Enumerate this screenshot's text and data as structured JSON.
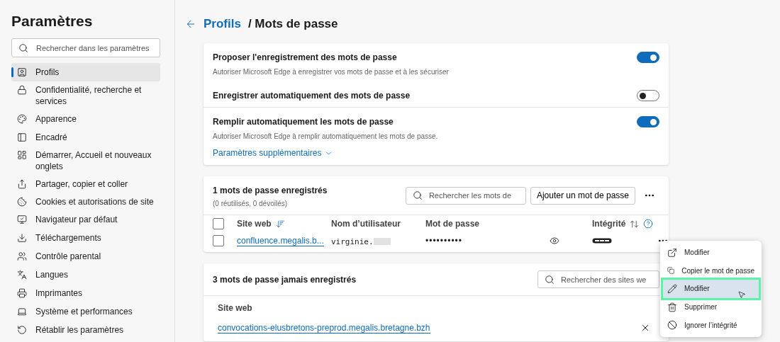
{
  "sidebar": {
    "title": "Paramètres",
    "search": {
      "placeholder": "Rechercher dans les paramètres"
    },
    "items": [
      {
        "label": "Profils",
        "selected": true
      },
      {
        "label": "Confidentialité, recherche et services",
        "selected": false
      },
      {
        "label": "Apparence",
        "selected": false
      },
      {
        "label": "Encadré",
        "selected": false
      },
      {
        "label": "Démarrer, Accueil et nouveaux onglets",
        "selected": false
      },
      {
        "label": "Partager, copier et coller",
        "selected": false
      },
      {
        "label": "Cookies et autorisations de site",
        "selected": false
      },
      {
        "label": "Navigateur par défaut",
        "selected": false
      },
      {
        "label": "Téléchargements",
        "selected": false
      },
      {
        "label": "Contrôle parental",
        "selected": false
      },
      {
        "label": "Langues",
        "selected": false
      },
      {
        "label": "Imprimantes",
        "selected": false
      },
      {
        "label": "Système et performances",
        "selected": false
      },
      {
        "label": "Rétablir les paramètres",
        "selected": false
      }
    ]
  },
  "breadcrumb": {
    "link": "Profils",
    "current": "/ Mots de passe"
  },
  "settings": {
    "rows": [
      {
        "label": "Proposer l'enregistrement des mots de passe",
        "description": "Autoriser Microsoft Edge à enregistrer vos mots de passe et à les sécuriser",
        "on": true
      },
      {
        "label": "Enregistrer automatiquement des mots de passe",
        "on": false
      },
      {
        "label": "Remplir automatiquement les mots de passe",
        "description": "Autoriser Microsoft Edge à remplir automatiquement les mots de passe.",
        "on": true
      }
    ],
    "more_link": "Paramètres supplémentaires"
  },
  "saved": {
    "title": "1 mots de passe enregistrés",
    "subtitle": "(0 réutilisés, 0 dévoilés)",
    "search": {
      "placeholder": "Rechercher les mots de"
    },
    "add_button": "Ajouter un mot de passe",
    "all_checked": false,
    "columns": [
      "Site web",
      "Nom d’utilisateur",
      "Mot de passe",
      "Intégrité"
    ],
    "rows": [
      {
        "site": "confluence.megalis.b...",
        "username": "virginie.",
        "password": "••••••••••",
        "checked": false
      }
    ]
  },
  "never_saved": {
    "title": "3 mots de passe jamais enregistrés",
    "search": {
      "placeholder": "Rechercher des sites we"
    },
    "column": "Site web",
    "rows": [
      {
        "site": "convocations-elusbretons-preprod.megalis.bretagne.bzh"
      }
    ]
  },
  "context_menu": {
    "items": [
      {
        "label": "Modifier",
        "selected": false
      },
      {
        "label": "Copier le mot de passe",
        "selected": false
      },
      {
        "label": "Modifier",
        "selected": true
      },
      {
        "label": "Supprimer",
        "selected": false
      },
      {
        "label": "Ignorer l’intégrité",
        "selected": false
      }
    ]
  }
}
